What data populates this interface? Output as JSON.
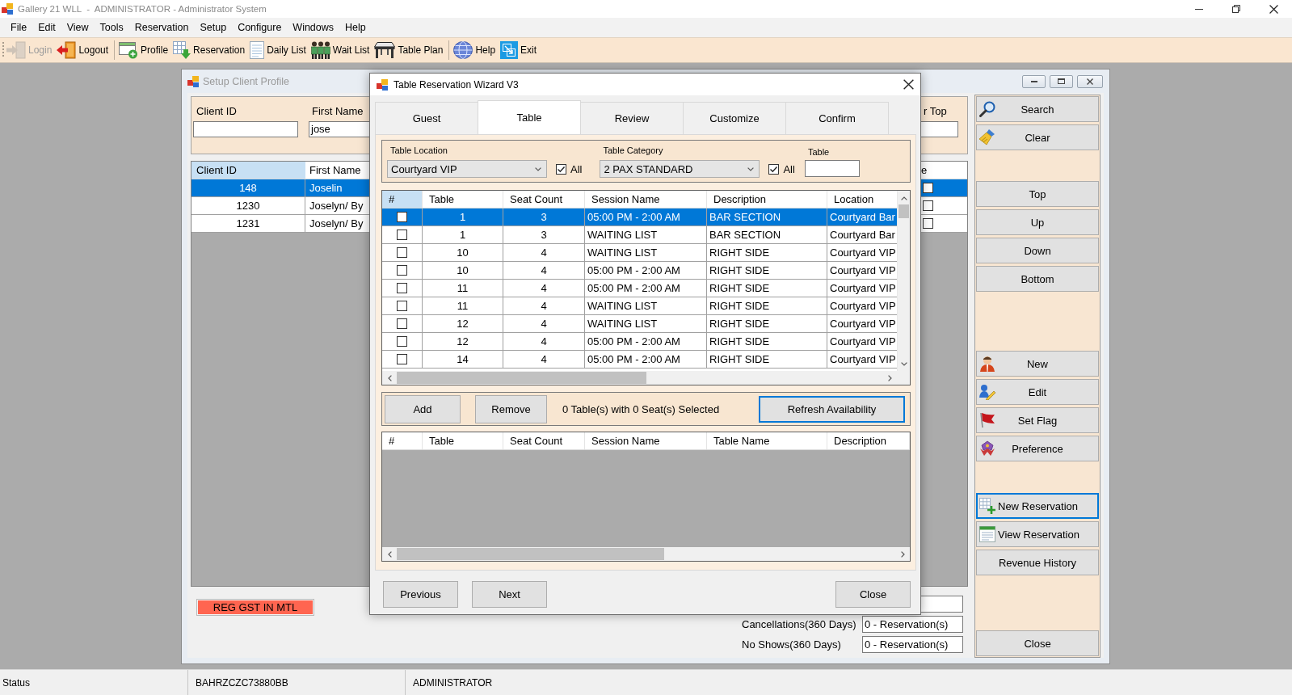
{
  "app": {
    "title": "Gallery 21 WLL  -  ADMINISTRATOR - Administrator System"
  },
  "menu": [
    "File",
    "Edit",
    "View",
    "Tools",
    "Reservation",
    "Setup",
    "Configure",
    "Windows",
    "Help"
  ],
  "toolbar": [
    {
      "items": [
        {
          "label": "Login",
          "disabled": true
        },
        {
          "label": "Logout",
          "disabled": false
        }
      ]
    },
    {
      "items": [
        {
          "label": "Profile",
          "disabled": false
        },
        {
          "label": "Reservation",
          "disabled": false
        },
        {
          "label": "Daily List",
          "disabled": false
        },
        {
          "label": "Wait List",
          "disabled": false
        },
        {
          "label": "Table Plan",
          "disabled": false
        }
      ]
    },
    {
      "items": [
        {
          "label": "Help",
          "disabled": false
        },
        {
          "label": "Exit",
          "disabled": false
        }
      ]
    }
  ],
  "client_profile": {
    "title": "Setup Client Profile",
    "search_fields": [
      {
        "label": "Client ID"
      },
      {
        "label": "First Name",
        "value": "jose"
      },
      {
        "label": "r Top"
      }
    ],
    "grid": {
      "columns": [
        {
          "label": "Client ID",
          "selected": true
        },
        {
          "label": "First Name",
          "selected": false
        },
        {
          "label": "e",
          "selected": false
        }
      ],
      "rows": [
        {
          "selected": true,
          "checked": false,
          "cells": [
            "148",
            "Joselin"
          ]
        },
        {
          "selected": false,
          "checked": false,
          "cells": [
            "1230",
            "Joselyn/ By"
          ]
        },
        {
          "selected": false,
          "checked": false,
          "cells": [
            "1231",
            "Joselyn/ By"
          ]
        }
      ]
    },
    "flag": "REG GST IN MTL",
    "stats": [
      {
        "label": "Cancellations(360 Days)",
        "value": "0 - Reservation(s)"
      },
      {
        "label": "No Shows(360 Days)",
        "value": "0 - Reservation(s)"
      }
    ],
    "side_buttons": [
      {
        "buttons": [
          {
            "label": "Search",
            "focused": false
          },
          {
            "label": "Clear",
            "focused": false
          }
        ]
      },
      {
        "buttons": [
          {
            "label": "Top",
            "focused": false
          },
          {
            "label": "Up",
            "focused": false
          },
          {
            "label": "Down",
            "focused": false
          },
          {
            "label": "Bottom",
            "focused": false
          }
        ]
      },
      {
        "buttons": [
          {
            "label": "New",
            "focused": false
          },
          {
            "label": "Edit",
            "focused": false
          },
          {
            "label": "Set Flag",
            "focused": false
          },
          {
            "label": "Preference",
            "focused": false
          }
        ]
      },
      {
        "buttons": [
          {
            "label": "New Reservation",
            "focused": true
          },
          {
            "label": "View Reservation",
            "focused": false
          },
          {
            "label": "Revenue History",
            "focused": false
          }
        ]
      },
      {
        "buttons": [
          {
            "label": "Close",
            "focused": false
          }
        ]
      }
    ]
  },
  "wizard": {
    "title": "Table Reservation Wizard V3",
    "tabs": [
      {
        "label": "Guest",
        "selected": false
      },
      {
        "label": "Table",
        "selected": true
      },
      {
        "label": "Review",
        "selected": false
      },
      {
        "label": "Customize",
        "selected": false
      },
      {
        "label": "Confirm",
        "selected": false
      }
    ],
    "filters": [
      {
        "label": "Table Location",
        "value": "Courtyard VIP",
        "all_label": "All",
        "all_checked": true
      },
      {
        "label": "Table Category",
        "value": "2 PAX STANDARD",
        "all_label": "All",
        "all_checked": true
      }
    ],
    "table_field": {
      "label": "Table"
    },
    "available": {
      "check_column": {
        "label": "#",
        "selected": true
      },
      "columns": [
        {
          "label": "Table",
          "selected": false
        },
        {
          "label": "Seat Count",
          "selected": false
        },
        {
          "label": "Session Name",
          "selected": false
        },
        {
          "label": "Description",
          "selected": false
        },
        {
          "label": "Location",
          "selected": false
        }
      ],
      "rows": [
        {
          "checked": false,
          "selected": true,
          "cells": [
            "1",
            "3",
            "05:00 PM - 2:00 AM",
            "BAR SECTION",
            "Courtyard Bar"
          ]
        },
        {
          "checked": false,
          "selected": false,
          "cells": [
            "1",
            "3",
            "WAITING LIST",
            "BAR SECTION",
            "Courtyard Bar"
          ]
        },
        {
          "checked": false,
          "selected": false,
          "cells": [
            "10",
            "4",
            "WAITING LIST",
            "RIGHT SIDE",
            "Courtyard VIP"
          ]
        },
        {
          "checked": false,
          "selected": false,
          "cells": [
            "10",
            "4",
            "05:00 PM - 2:00 AM",
            "RIGHT SIDE",
            "Courtyard VIP"
          ]
        },
        {
          "checked": false,
          "selected": false,
          "cells": [
            "11",
            "4",
            "05:00 PM - 2:00 AM",
            "RIGHT SIDE",
            "Courtyard VIP"
          ]
        },
        {
          "checked": false,
          "selected": false,
          "cells": [
            "11",
            "4",
            "WAITING LIST",
            "RIGHT SIDE",
            "Courtyard VIP"
          ]
        },
        {
          "checked": false,
          "selected": false,
          "cells": [
            "12",
            "4",
            "WAITING LIST",
            "RIGHT SIDE",
            "Courtyard VIP"
          ]
        },
        {
          "checked": false,
          "selected": false,
          "cells": [
            "12",
            "4",
            "05:00 PM - 2:00 AM",
            "RIGHT SIDE",
            "Courtyard VIP"
          ]
        },
        {
          "checked": false,
          "selected": false,
          "cells": [
            "14",
            "4",
            "05:00 PM - 2:00 AM",
            "RIGHT SIDE",
            "Courtyard VIP"
          ]
        }
      ]
    },
    "actions": {
      "add": "Add",
      "remove": "Remove",
      "summary": "0 Table(s) with 0 Seat(s) Selected",
      "refresh": {
        "label": "Refresh Availability",
        "focused": true
      }
    },
    "chosen": {
      "check_column": {
        "label": "#",
        "selected": false
      },
      "columns": [
        {
          "label": "Table",
          "selected": false
        },
        {
          "label": "Seat Count",
          "selected": false
        },
        {
          "label": "Session Name",
          "selected": false
        },
        {
          "label": "Table Name",
          "selected": false
        },
        {
          "label": "Description",
          "selected": false
        }
      ]
    },
    "nav_buttons": [
      "Previous",
      "Next"
    ],
    "close_button": "Close"
  },
  "status_bar": [
    "Status",
    "BAHRZCZC73880BB",
    "ADMINISTRATOR"
  ]
}
